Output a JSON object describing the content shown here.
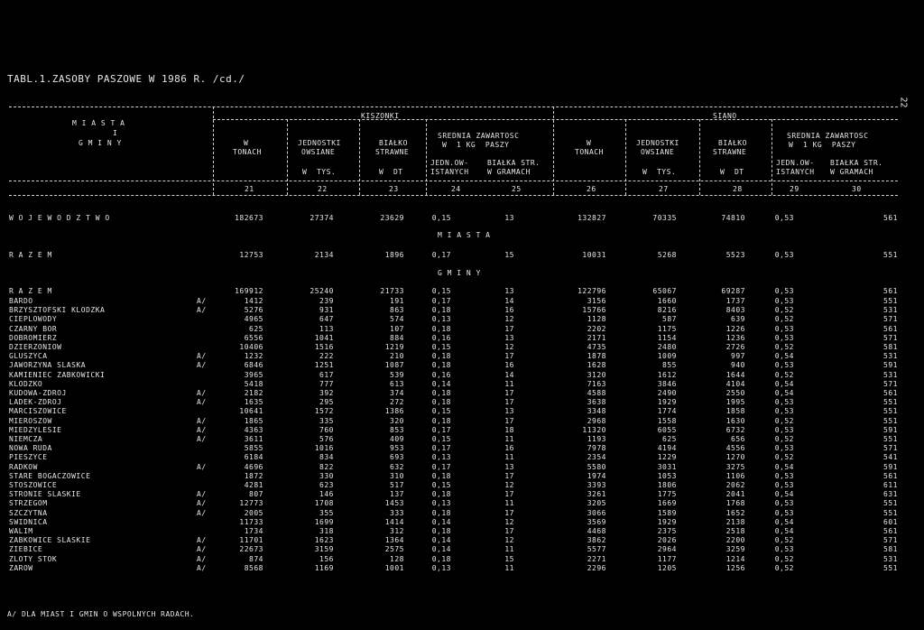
{
  "title": "TABL.1.ZASOBY PASZOWE W 1986 R. /cd./",
  "page_number": "22",
  "header": {
    "left": [
      "M I A S T A",
      "I",
      "G M I N Y"
    ],
    "kiszonki": "KISZONKI",
    "siano": "SIANO",
    "col_w_tonach": [
      "W",
      "TONACH"
    ],
    "col_jedn": [
      "JEDNOSTKI",
      "OWSIANE",
      "W  TYS."
    ],
    "col_bialko": [
      "BIAŁKO",
      "STRAWNE",
      "W  DT"
    ],
    "col_srednia": [
      "SREDNIA ZAWARTOSC",
      "W  1 KG  PASZY"
    ],
    "col_jedn_ow": [
      "JEDN.OW-",
      "ISTANYCH"
    ],
    "col_bialka": [
      "BIAŁKA STR.",
      "W GRAMACH"
    ],
    "col_numbers": [
      "21",
      "22",
      "23",
      "24",
      "25",
      "26",
      "27",
      "28",
      "29",
      "30"
    ]
  },
  "sections": {
    "wojewodztwo": "W O J E W O D Z T W O",
    "miasta": "M I A S T A",
    "gminy": "G M I N Y",
    "razem": "R A Z E M"
  },
  "summary_rows": [
    {
      "name": "W O J E W O D Z T W O",
      "mark": "",
      "v": [
        "182673",
        "27374",
        "23629",
        "0,15",
        "13",
        "132827",
        "70335",
        "74810",
        "0,53",
        "561"
      ]
    },
    {
      "name": "R A Z E M",
      "mark": "",
      "v": [
        "12753",
        "2134",
        "1896",
        "0,17",
        "15",
        "10031",
        "5268",
        "5523",
        "0,53",
        "551"
      ]
    },
    {
      "name": "R A Z E M",
      "mark": "",
      "v": [
        "169912",
        "25240",
        "21733",
        "0,15",
        "13",
        "122796",
        "65067",
        "69287",
        "0,53",
        "561"
      ]
    }
  ],
  "rows": [
    {
      "name": "BARDO",
      "mark": "A/",
      "v": [
        "1412",
        "239",
        "191",
        "0,17",
        "14",
        "3156",
        "1660",
        "1737",
        "0,53",
        "551"
      ]
    },
    {
      "name": "BRZYSZTOFSKI KLODZKA",
      "mark": "A/",
      "v": [
        "5276",
        "931",
        "863",
        "0,18",
        "16",
        "15766",
        "8216",
        "8403",
        "0,52",
        "531"
      ]
    },
    {
      "name": "CIEPLOWODY",
      "mark": "",
      "v": [
        "4965",
        "647",
        "574",
        "0,13",
        "12",
        "1128",
        "587",
        "639",
        "0,52",
        "571"
      ]
    },
    {
      "name": "CZARNY BOR",
      "mark": "",
      "v": [
        "625",
        "113",
        "107",
        "0,18",
        "17",
        "2202",
        "1175",
        "1226",
        "0,53",
        "561"
      ]
    },
    {
      "name": "DOBROMIERZ",
      "mark": "",
      "v": [
        "6556",
        "1041",
        "884",
        "0,16",
        "13",
        "2171",
        "1154",
        "1236",
        "0,53",
        "571"
      ]
    },
    {
      "name": "DZIERZONIOW",
      "mark": "",
      "v": [
        "10406",
        "1516",
        "1219",
        "0,15",
        "12",
        "4735",
        "2480",
        "2726",
        "0,52",
        "581"
      ]
    },
    {
      "name": "GLUSZYCA",
      "mark": "A/",
      "v": [
        "1232",
        "222",
        "210",
        "0,18",
        "17",
        "1878",
        "1009",
        "997",
        "0,54",
        "531"
      ]
    },
    {
      "name": "JAWORZYNA SLASKA",
      "mark": "A/",
      "v": [
        "6846",
        "1251",
        "1087",
        "0,18",
        "16",
        "1628",
        "855",
        "940",
        "0,53",
        "591"
      ]
    },
    {
      "name": "KAMIENIEC ZABKOWICKI",
      "mark": "",
      "v": [
        "3965",
        "617",
        "539",
        "0,16",
        "14",
        "3120",
        "1612",
        "1644",
        "0,52",
        "531"
      ]
    },
    {
      "name": "KLODZKO",
      "mark": "",
      "v": [
        "5418",
        "777",
        "613",
        "0,14",
        "11",
        "7163",
        "3846",
        "4104",
        "0,54",
        "571"
      ]
    },
    {
      "name": "KUDOWA-ZDROJ",
      "mark": "A/",
      "v": [
        "2182",
        "392",
        "374",
        "0,18",
        "17",
        "4588",
        "2490",
        "2550",
        "0,54",
        "561"
      ]
    },
    {
      "name": "LADEK-ZDROJ",
      "mark": "A/",
      "v": [
        "1635",
        "295",
        "272",
        "0,18",
        "17",
        "3638",
        "1929",
        "1995",
        "0,53",
        "551"
      ]
    },
    {
      "name": "MARCISZOWICE",
      "mark": "",
      "v": [
        "10641",
        "1572",
        "1386",
        "0,15",
        "13",
        "3348",
        "1774",
        "1858",
        "0,53",
        "551"
      ]
    },
    {
      "name": "MIEROSZOW",
      "mark": "A/",
      "v": [
        "1865",
        "335",
        "320",
        "0,18",
        "17",
        "2968",
        "1558",
        "1630",
        "0,52",
        "551"
      ]
    },
    {
      "name": "MIEDZYLESIE",
      "mark": "A/",
      "v": [
        "4363",
        "760",
        "853",
        "0,17",
        "18",
        "11320",
        "6055",
        "6732",
        "0,53",
        "591"
      ]
    },
    {
      "name": "NIEMCZA",
      "mark": "A/",
      "v": [
        "3611",
        "576",
        "409",
        "0,15",
        "11",
        "1193",
        "625",
        "656",
        "0,52",
        "551"
      ]
    },
    {
      "name": "NOWA RUDA",
      "mark": "",
      "v": [
        "5855",
        "1016",
        "953",
        "0,17",
        "16",
        "7978",
        "4194",
        "4556",
        "0,53",
        "571"
      ]
    },
    {
      "name": "PIESZYCE",
      "mark": "",
      "v": [
        "6184",
        "834",
        "693",
        "0,13",
        "11",
        "2354",
        "1229",
        "1270",
        "0,52",
        "541"
      ]
    },
    {
      "name": "RADKOW",
      "mark": "A/",
      "v": [
        "4696",
        "822",
        "632",
        "0,17",
        "13",
        "5580",
        "3031",
        "3275",
        "0,54",
        "591"
      ]
    },
    {
      "name": "STARE BOGACZOWICE",
      "mark": "",
      "v": [
        "1872",
        "330",
        "310",
        "0,18",
        "17",
        "1974",
        "1053",
        "1106",
        "0,53",
        "561"
      ]
    },
    {
      "name": "STOSZOWICE",
      "mark": "",
      "v": [
        "4281",
        "623",
        "517",
        "0,15",
        "12",
        "3393",
        "1806",
        "2062",
        "0,53",
        "611"
      ]
    },
    {
      "name": "STRONIE SLASKIE",
      "mark": "A/",
      "v": [
        "807",
        "146",
        "137",
        "0,18",
        "17",
        "3261",
        "1775",
        "2041",
        "0,54",
        "631"
      ]
    },
    {
      "name": "STRZEGOM",
      "mark": "A/",
      "v": [
        "12773",
        "1708",
        "1453",
        "0,13",
        "11",
        "3205",
        "1669",
        "1768",
        "0,53",
        "551"
      ]
    },
    {
      "name": "SZCZYTNA",
      "mark": "A/",
      "v": [
        "2005",
        "355",
        "333",
        "0,18",
        "17",
        "3066",
        "1589",
        "1652",
        "0,53",
        "551"
      ]
    },
    {
      "name": "SWIDNICA",
      "mark": "",
      "v": [
        "11733",
        "1699",
        "1414",
        "0,14",
        "12",
        "3569",
        "1929",
        "2138",
        "0,54",
        "601"
      ]
    },
    {
      "name": "WALIM",
      "mark": "",
      "v": [
        "1734",
        "318",
        "312",
        "0,18",
        "17",
        "4468",
        "2375",
        "2518",
        "0,54",
        "561"
      ]
    },
    {
      "name": "ZABKOWICE SLASKIE",
      "mark": "A/",
      "v": [
        "11701",
        "1623",
        "1364",
        "0,14",
        "12",
        "3862",
        "2026",
        "2200",
        "0,52",
        "571"
      ]
    },
    {
      "name": "ZIEBICE",
      "mark": "A/",
      "v": [
        "22673",
        "3159",
        "2575",
        "0,14",
        "11",
        "5577",
        "2964",
        "3259",
        "0,53",
        "581"
      ]
    },
    {
      "name": "ZLOTY STOK",
      "mark": "A/",
      "v": [
        "874",
        "156",
        "128",
        "0,18",
        "15",
        "2271",
        "1177",
        "1214",
        "0,52",
        "531"
      ]
    },
    {
      "name": "ZAROW",
      "mark": "A/",
      "v": [
        "8568",
        "1169",
        "1001",
        "0,13",
        "11",
        "2296",
        "1205",
        "1256",
        "0,52",
        "551"
      ]
    }
  ],
  "footnote": "A/ DLA MIAST I GMIN O WSPOLNYCH RADACH."
}
